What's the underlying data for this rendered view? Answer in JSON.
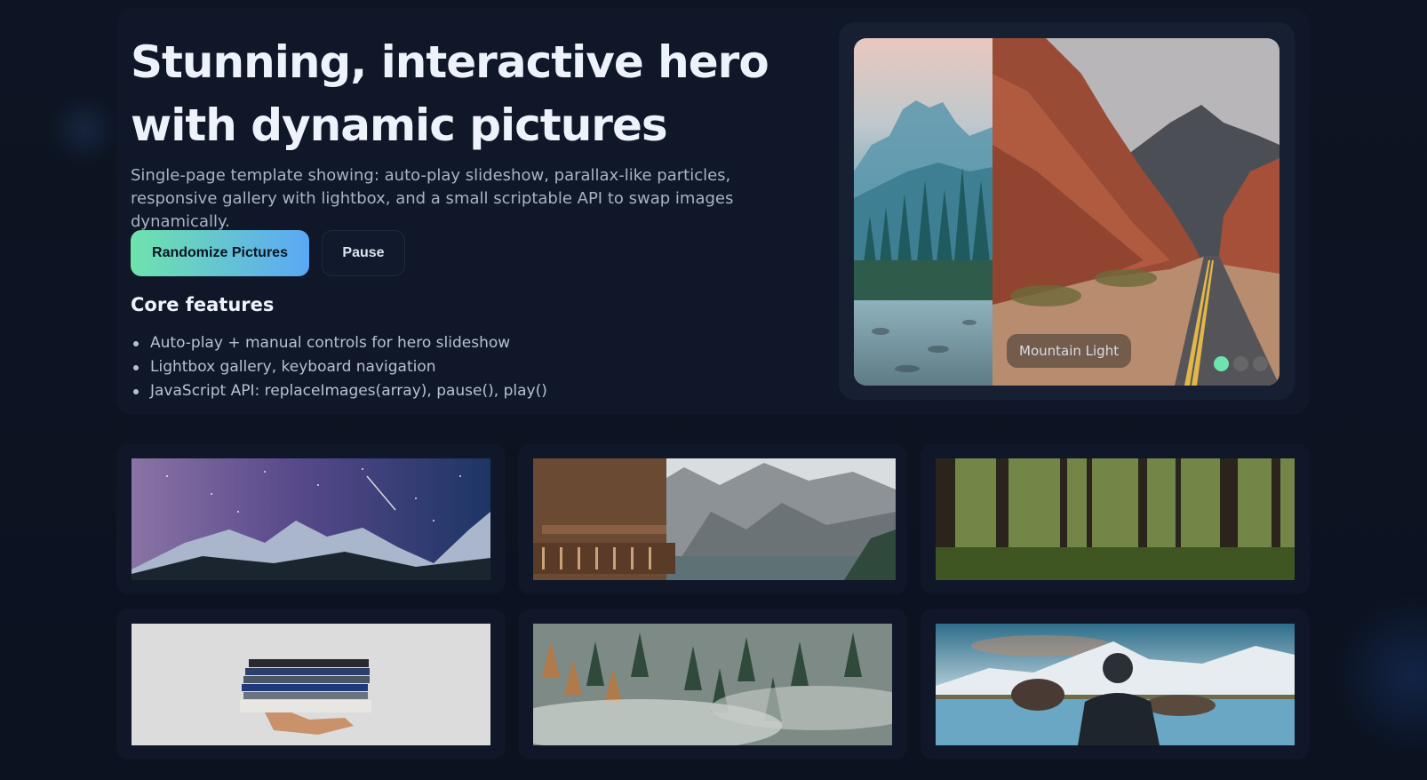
{
  "hero": {
    "title": "Stunning, interactive hero with dynamic pictures",
    "description": "Single-page template showing: auto-play slideshow, parallax-like particles, responsive gallery with lightbox, and a small scriptable API to swap images dynamically.",
    "buttons": {
      "randomize_label": "Randomize Pictures",
      "pause_label": "Pause"
    },
    "features": {
      "heading": "Core features",
      "items": [
        "Auto-play + manual controls for hero slideshow",
        "Lightbox gallery, keyboard navigation",
        "JavaScript API: replaceImages(array), pause(), play()"
      ]
    }
  },
  "slideshow": {
    "caption": "Mountain Light",
    "dots": 3,
    "active_dot": 0
  },
  "gallery": {
    "images": [
      "milky-way-mountains",
      "mountain-lake-chalet",
      "forest-trees",
      "stack-of-books",
      "misty-forest",
      "person-at-mountain-lake"
    ]
  },
  "colors": {
    "background": "#0c1322",
    "accent_green": "#6fe3ad",
    "accent_blue": "#5aa8f5"
  }
}
